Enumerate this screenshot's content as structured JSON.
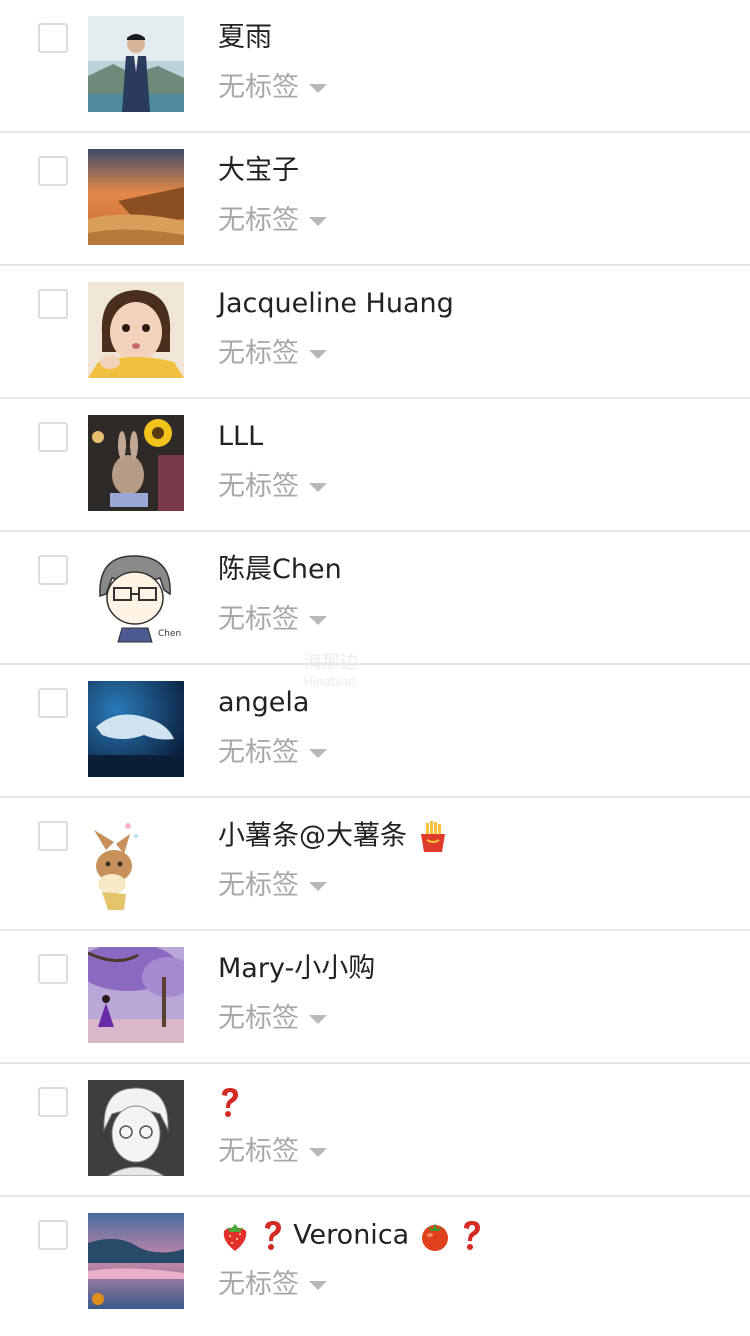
{
  "tag_label": "无标签",
  "contacts": [
    {
      "name": "夏雨",
      "avatar": "avatar-businessman-coast"
    },
    {
      "name": "大宝子",
      "avatar": "avatar-sunset-cliffs"
    },
    {
      "name": "Jacqueline Huang",
      "avatar": "avatar-girl-selfie"
    },
    {
      "name": "LLL",
      "avatar": "avatar-sunflower-rabbit"
    },
    {
      "name": "陈晨Chen",
      "avatar": "avatar-cartoon-boy-glasses"
    },
    {
      "name": "angela",
      "avatar": "avatar-beluga-whale"
    },
    {
      "name": "小薯条@大薯条",
      "avatar": "avatar-eevee-cartoon",
      "suffix_emoji": "fries-emoji"
    },
    {
      "name": "Mary-小小购",
      "avatar": "avatar-purple-tree-girl"
    },
    {
      "name": "",
      "avatar": "avatar-sketch-boy",
      "emojis": [
        "question-mark-emoji"
      ]
    },
    {
      "name": "Veronica",
      "avatar": "avatar-pink-lake",
      "prefix_emojis": [
        "strawberry-emoji",
        "question-mark-emoji"
      ],
      "suffix_emojis": [
        "tomato-emoji",
        "question-mark-emoji"
      ]
    }
  ],
  "watermark": {
    "line1": "海那边",
    "line2": "Hinabian"
  },
  "colors": {
    "divider": "#e6e6e6",
    "tag_text": "#a8a8a8",
    "name_text": "#222222"
  }
}
